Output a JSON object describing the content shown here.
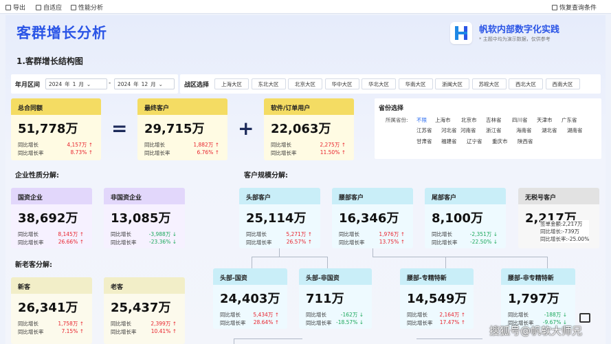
{
  "toolbar": {
    "export": "导出",
    "adaptive": "自适应",
    "perf": "性能分析",
    "restore": "恢复查询条件"
  },
  "header": {
    "title": "客群增长分析",
    "brand_name": "帆软内部数字化实践",
    "brand_sub": "* 主题中均为演示数据，仅供参考"
  },
  "section1": "1.客群增长结构图",
  "filters": {
    "date_label": "年月区间",
    "from_year": "2024",
    "from_unit_y": "年",
    "from_month": "1",
    "from_unit_m": "月",
    "sep": "-",
    "to_year": "2024",
    "to_unit_y": "年",
    "to_month": "12",
    "to_unit_m": "月",
    "region_label": "战区选择",
    "regions": [
      "上海大区",
      "东北大区",
      "北京大区",
      "华中大区",
      "华北大区",
      "华南大区",
      "浙闽大区",
      "苏皖大区",
      "西北大区",
      "西南大区"
    ]
  },
  "province": {
    "title": "省份选择",
    "sub_label": "所属省份:",
    "rows": [
      [
        "不限",
        "上海市",
        "北京市",
        "吉林省",
        "四川省",
        "天津市",
        "广东省"
      ],
      [
        "江苏省",
        "河北省",
        "河南省",
        "浙江省",
        "海南省",
        "湖北省",
        "湖南省"
      ],
      [
        "甘肃省",
        "福建省",
        "辽宁省",
        "重庆市",
        "陕西省"
      ]
    ]
  },
  "labels": {
    "growth": "同比增长",
    "rate": "同比增长率",
    "enterprise": "企业性质分解:",
    "scale": "客户规模分解:",
    "newold": "新老客分解:"
  },
  "cards": {
    "total": {
      "title": "总合同额",
      "value": "51,778万",
      "g": "4,157万 ↑",
      "r": "8.73% ↑"
    },
    "final": {
      "title": "最终客户",
      "value": "29,715万",
      "g": "1,882万 ↑",
      "r": "6.76% ↑"
    },
    "soft": {
      "title": "软件/订单用户",
      "value": "22,063万",
      "g": "2,275万 ↑",
      "r": "11.50% ↑"
    },
    "soe": {
      "title": "国资企业",
      "value": "38,692万",
      "g": "8,145万 ↑",
      "r": "26.66% ↑"
    },
    "nsoe": {
      "title": "非国资企业",
      "value": "13,085万",
      "g": "-3,988万 ↓",
      "r": "-23.36% ↓"
    },
    "head": {
      "title": "头部客户",
      "value": "25,114万",
      "g": "5,271万 ↑",
      "r": "26.57% ↑"
    },
    "waist": {
      "title": "腰部客户",
      "value": "16,346万",
      "g": "1,976万 ↑",
      "r": "13.75% ↑"
    },
    "tail": {
      "title": "尾部客户",
      "value": "8,100万",
      "g": "-2,351万 ↓",
      "r": "-22.50% ↓"
    },
    "notax": {
      "title": "无税号客户",
      "value": "2,217万"
    },
    "new": {
      "title": "新客",
      "value": "26,341万",
      "g": "1,758万 ↑",
      "r": "7.15% ↑"
    },
    "old": {
      "title": "老客",
      "value": "25,437万",
      "g": "2,399万 ↑",
      "r": "10.41% ↑"
    },
    "head_soe": {
      "title": "头部-国资",
      "value": "24,403万",
      "g": "5,434万 ↑",
      "r": "28.64% ↑"
    },
    "head_nsoe": {
      "title": "头部-非国资",
      "value": "711万",
      "g": "-162万 ↓",
      "r": "-18.57% ↓"
    },
    "waist_sp": {
      "title": "腰部-专精特新",
      "value": "14,549万",
      "g": "2,164万 ↑",
      "r": "17.47% ↑"
    },
    "waist_nsp": {
      "title": "腰部-非专精特新",
      "value": "1,797万",
      "g": "-188万 ↓",
      "r": "-9.67% ↓"
    }
  },
  "ops": {
    "eq": "=",
    "plus": "+"
  },
  "tooltip": {
    "l1": "签单金额:2,217万",
    "l2": "同比增长:-739万",
    "l3": "同比增长率:-25.00%"
  },
  "watermark": "搜狐号@帆软大师兄"
}
